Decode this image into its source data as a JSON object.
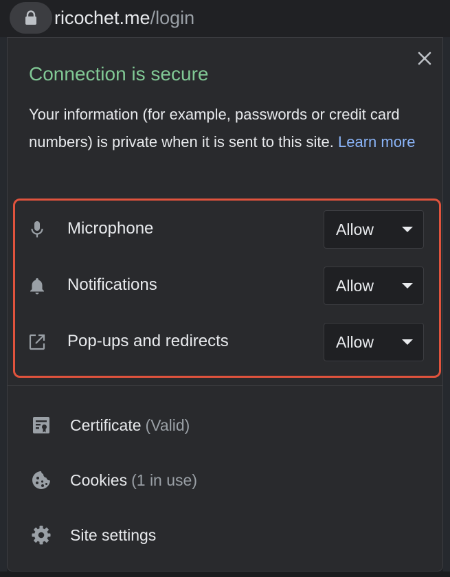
{
  "address_bar": {
    "lock_icon": "lock-icon",
    "domain": "ricochet.me",
    "path": "/login"
  },
  "popup": {
    "close_icon": "close-icon",
    "title": "Connection is secure",
    "description": "Your information (for example, passwords or credit card numbers) is private when it is sent to this site.",
    "learn_more": "Learn more",
    "colors": {
      "title": "#81c995",
      "link": "#8ab4f8",
      "highlight_border": "#e0533d"
    },
    "permissions": [
      {
        "icon": "microphone-icon",
        "label": "Microphone",
        "value": "Allow"
      },
      {
        "icon": "bell-icon",
        "label": "Notifications",
        "value": "Allow"
      },
      {
        "icon": "open-external-icon",
        "label": "Pop-ups and redirects",
        "value": "Allow"
      }
    ],
    "menu": [
      {
        "icon": "certificate-icon",
        "label": "Certificate",
        "sub": "(Valid)"
      },
      {
        "icon": "cookie-icon",
        "label": "Cookies",
        "sub": "(1 in use)"
      },
      {
        "icon": "gear-icon",
        "label": "Site settings",
        "sub": ""
      }
    ]
  }
}
